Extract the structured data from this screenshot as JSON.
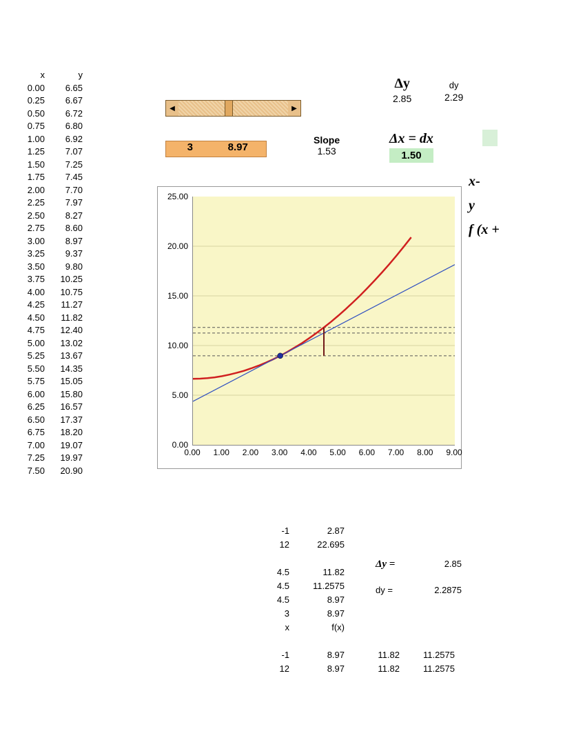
{
  "table": {
    "hx": "x",
    "hy": "y",
    "rows": [
      {
        "x": "0.00",
        "y": "6.65"
      },
      {
        "x": "0.25",
        "y": "6.67"
      },
      {
        "x": "0.50",
        "y": "6.72"
      },
      {
        "x": "0.75",
        "y": "6.80"
      },
      {
        "x": "1.00",
        "y": "6.92"
      },
      {
        "x": "1.25",
        "y": "7.07"
      },
      {
        "x": "1.50",
        "y": "7.25"
      },
      {
        "x": "1.75",
        "y": "7.45"
      },
      {
        "x": "2.00",
        "y": "7.70"
      },
      {
        "x": "2.25",
        "y": "7.97"
      },
      {
        "x": "2.50",
        "y": "8.27"
      },
      {
        "x": "2.75",
        "y": "8.60"
      },
      {
        "x": "3.00",
        "y": "8.97"
      },
      {
        "x": "3.25",
        "y": "9.37"
      },
      {
        "x": "3.50",
        "y": "9.80"
      },
      {
        "x": "3.75",
        "y": "10.25"
      },
      {
        "x": "4.00",
        "y": "10.75"
      },
      {
        "x": "4.25",
        "y": "11.27"
      },
      {
        "x": "4.50",
        "y": "11.82"
      },
      {
        "x": "4.75",
        "y": "12.40"
      },
      {
        "x": "5.00",
        "y": "13.02"
      },
      {
        "x": "5.25",
        "y": "13.67"
      },
      {
        "x": "5.50",
        "y": "14.35"
      },
      {
        "x": "5.75",
        "y": "15.05"
      },
      {
        "x": "6.00",
        "y": "15.80"
      },
      {
        "x": "6.25",
        "y": "16.57"
      },
      {
        "x": "6.50",
        "y": "17.37"
      },
      {
        "x": "6.75",
        "y": "18.20"
      },
      {
        "x": "7.00",
        "y": "19.07"
      },
      {
        "x": "7.25",
        "y": "19.97"
      },
      {
        "x": "7.50",
        "y": "20.90"
      }
    ]
  },
  "deltaY": {
    "sym": "Δy",
    "val": "2.85"
  },
  "dy": {
    "lbl": "dy",
    "val": "2.29"
  },
  "valbox": {
    "x": "3",
    "y": "8.97"
  },
  "slope": {
    "lbl": "Slope",
    "val": "1.53"
  },
  "dx": {
    "sym": "Δx = dx",
    "val": "1.50"
  },
  "sideLabels": {
    "a": "x",
    "dash": "-",
    "b": "y",
    "c": "f (x +"
  },
  "chart": {
    "yticks": [
      "0.00",
      "5.00",
      "10.00",
      "15.00",
      "20.00",
      "25.00"
    ],
    "xticks": [
      "0.00",
      "1.00",
      "2.00",
      "3.00",
      "4.00",
      "5.00",
      "6.00",
      "7.00",
      "8.00",
      "9.00"
    ]
  },
  "chart_data": {
    "type": "line",
    "xlim": [
      0,
      9
    ],
    "ylim": [
      0,
      25
    ],
    "series": [
      {
        "name": "f(x) curve",
        "color": "#d02020",
        "x": [
          0.0,
          0.25,
          0.5,
          0.75,
          1.0,
          1.25,
          1.5,
          1.75,
          2.0,
          2.25,
          2.5,
          2.75,
          3.0,
          3.25,
          3.5,
          3.75,
          4.0,
          4.25,
          4.5,
          4.75,
          5.0,
          5.25,
          5.5,
          5.75,
          6.0,
          6.25,
          6.5,
          6.75,
          7.0,
          7.25,
          7.5
        ],
        "y": [
          6.65,
          6.67,
          6.72,
          6.8,
          6.92,
          7.07,
          7.25,
          7.45,
          7.7,
          7.97,
          8.27,
          8.6,
          8.97,
          9.37,
          9.8,
          10.25,
          10.75,
          11.27,
          11.82,
          12.4,
          13.02,
          13.67,
          14.35,
          15.05,
          15.8,
          16.57,
          17.37,
          18.2,
          19.07,
          19.97,
          20.9
        ]
      },
      {
        "name": "tangent line",
        "color": "#3050c0",
        "x": [
          0,
          9
        ],
        "y": [
          4.38,
          18.15
        ]
      }
    ],
    "hlines": [
      8.97,
      11.2575,
      11.82
    ],
    "point": {
      "x": 3,
      "y": 8.97
    },
    "vsegment": {
      "x": 4.5,
      "y0": 8.97,
      "y1": 11.82
    }
  },
  "bottom": {
    "rows": [
      [
        "-1",
        "2.87"
      ],
      [
        "12",
        "22.695"
      ],
      [
        "",
        ""
      ],
      [
        "4.5",
        "11.82"
      ],
      [
        "4.5",
        "11.2575"
      ],
      [
        "4.5",
        "8.97"
      ],
      [
        "3",
        "8.97"
      ],
      [
        "x",
        "f(x)"
      ],
      [
        "",
        ""
      ],
      [
        "-1",
        "8.97",
        "11.82",
        "11.2575"
      ],
      [
        "12",
        "8.97",
        "11.82",
        "11.2575"
      ]
    ]
  },
  "bottomRight": {
    "r1": {
      "lbl": "Δy =",
      "val": "2.85"
    },
    "r2": {
      "lbl": "dy =",
      "val": "2.2875"
    }
  }
}
